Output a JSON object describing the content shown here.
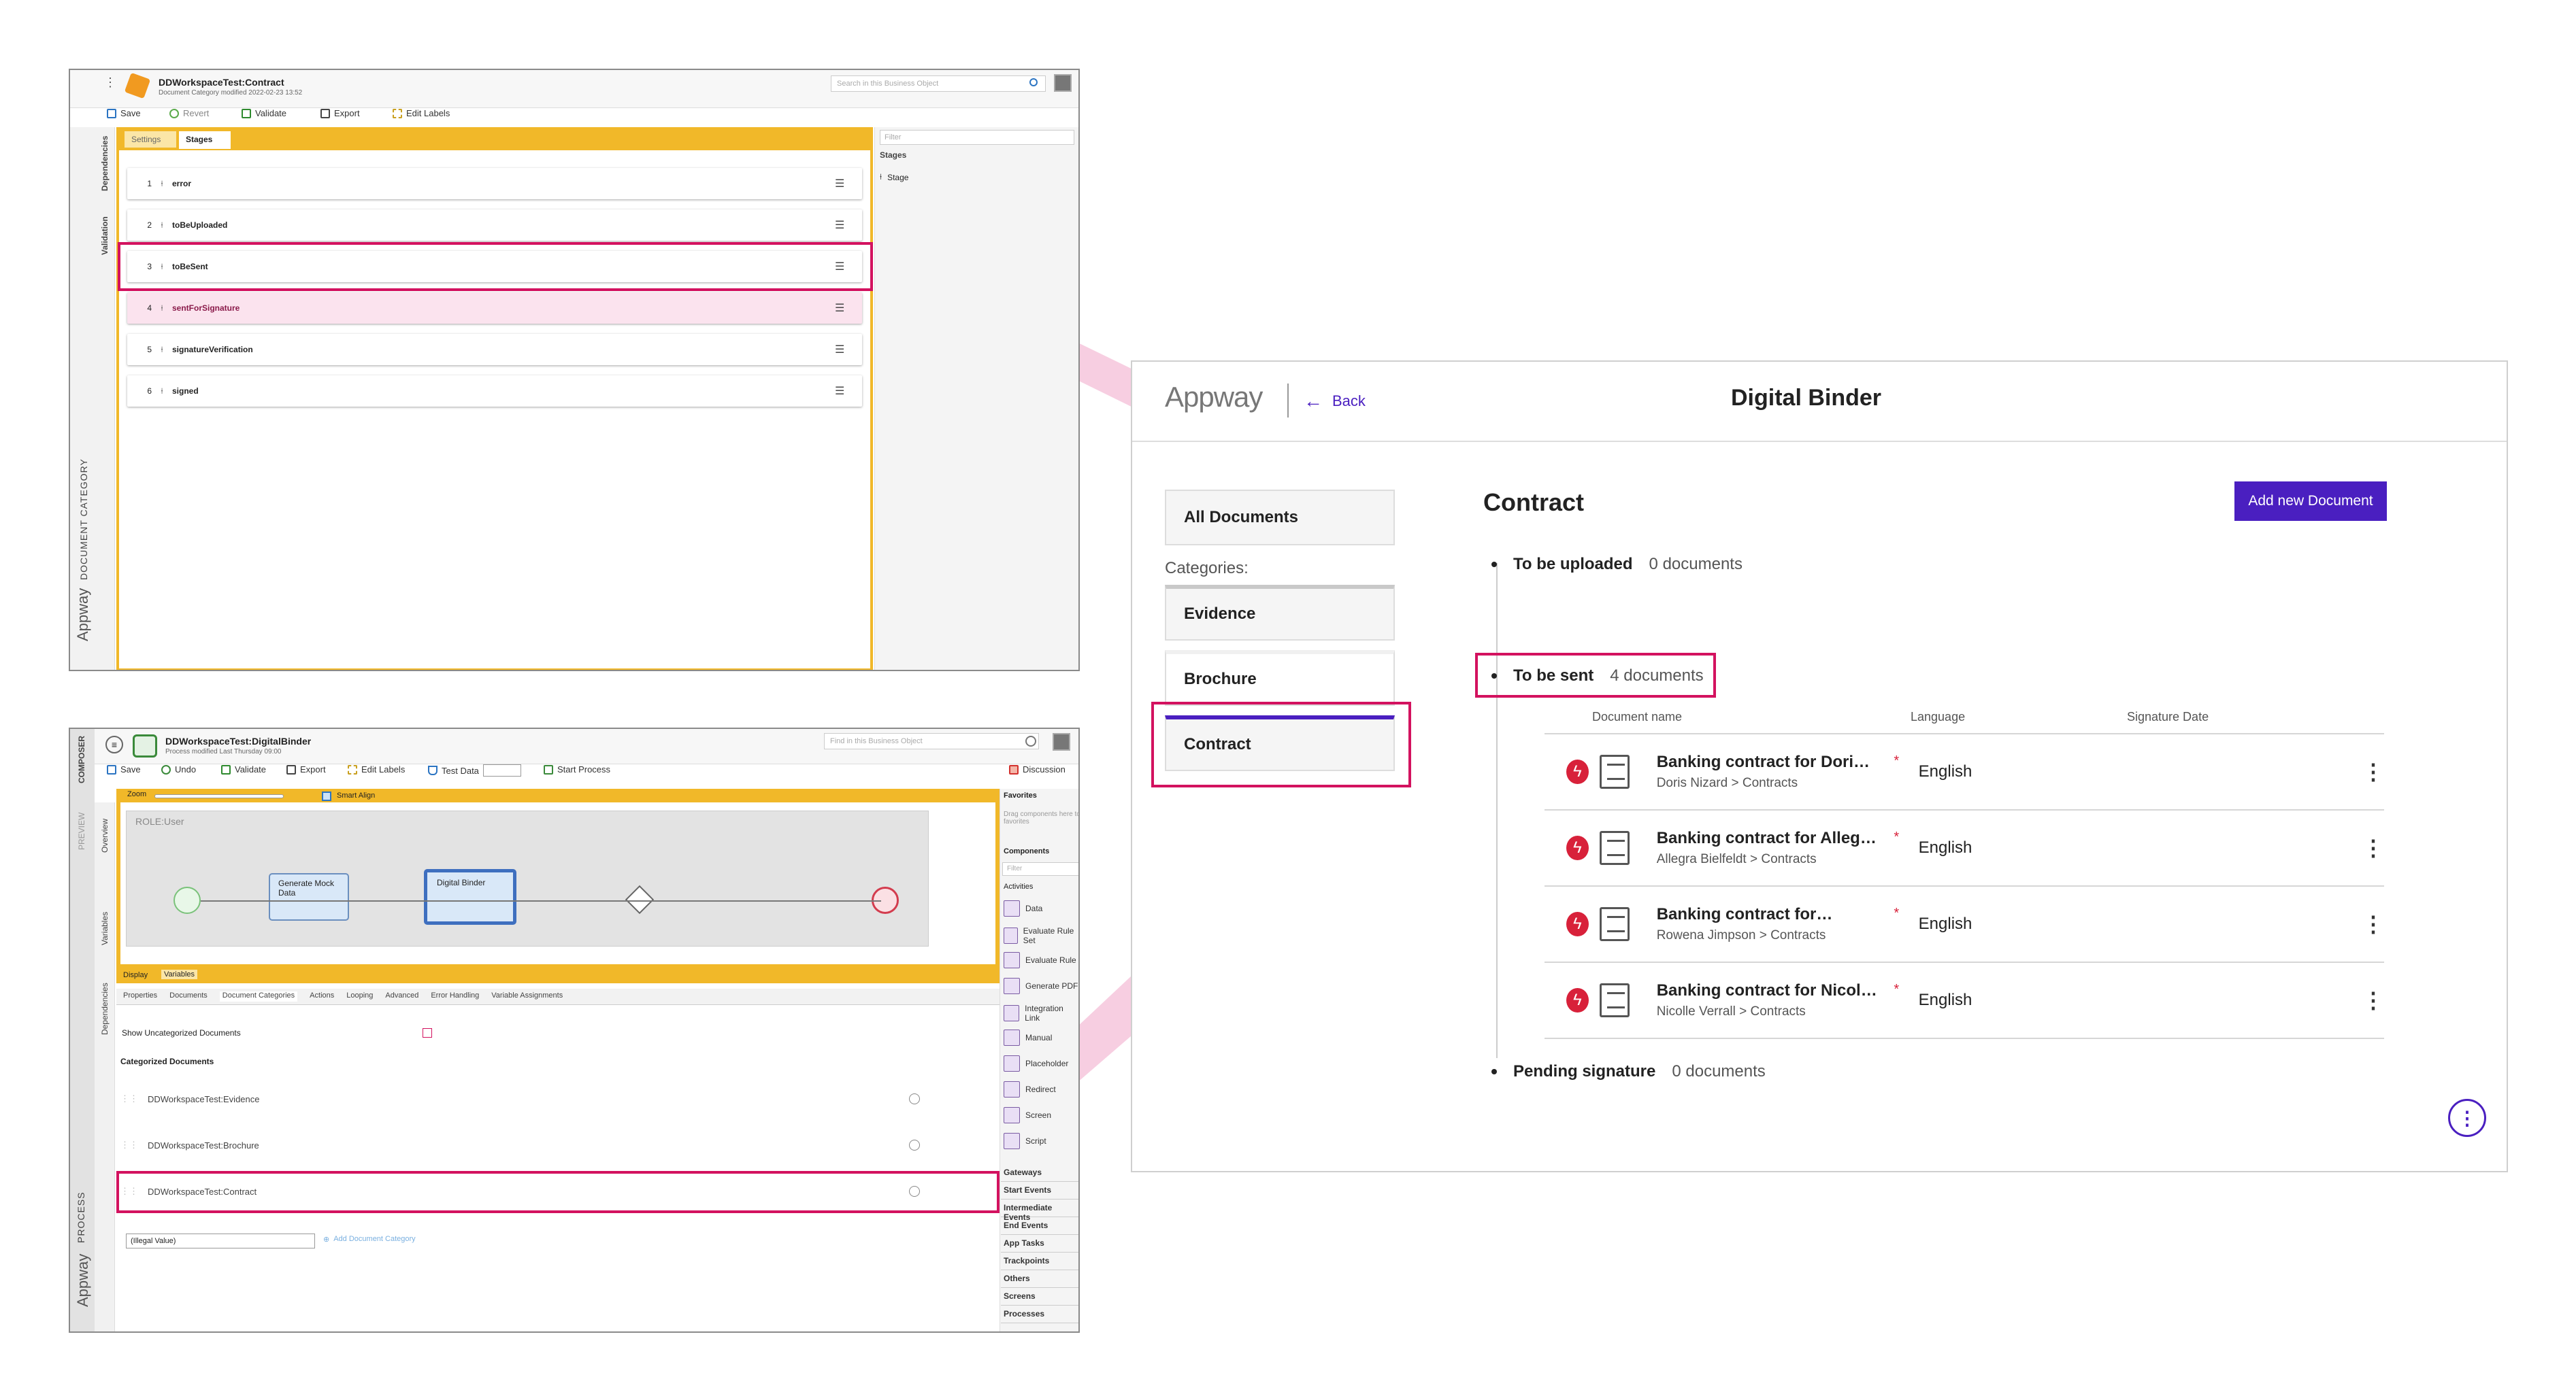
{
  "overlay": {
    "highlight_color": "#d3125f",
    "band_color": "#f6c6dc"
  },
  "panel1": {
    "title": "DDWorkspaceTest:Contract",
    "subtitle": "Document Category modified 2022-02-23 13:52",
    "search_placeholder": "Search in this Business Object",
    "toolbar": {
      "save": "Save",
      "revert": "Revert",
      "validate": "Validate",
      "export": "Export",
      "edit_labels": "Edit Labels"
    },
    "tabs": [
      "Settings",
      "Stages"
    ],
    "left_tabs": [
      "Dependencies",
      "Validation"
    ],
    "vertical_brand": "Appway",
    "vertical_caption": "DOCUMENT CATEGORY",
    "stages": [
      {
        "num": "1",
        "label": "error"
      },
      {
        "num": "2",
        "label": "toBeUploaded"
      },
      {
        "num": "3",
        "label": "toBeSent"
      },
      {
        "num": "4",
        "label": "sentForSignature"
      },
      {
        "num": "5",
        "label": "signatureVerification"
      },
      {
        "num": "6",
        "label": "signed"
      }
    ],
    "side_filter_placeholder": "Filter",
    "side_section": "Stages",
    "side_item": "Stage"
  },
  "panel2": {
    "title": "DDWorkspaceTest:DigitalBinder",
    "subtitle": "Process modified Last Thursday 09:00",
    "search_placeholder": "Find in this Business Object",
    "toolbar": {
      "save": "Save",
      "undo": "Undo",
      "validate": "Validate",
      "export": "Export",
      "edit_labels": "Edit Labels",
      "test_data": "Test Data",
      "start_process": "Start Process",
      "discussion": "Discussion"
    },
    "left_tabs": [
      "COMPOSER",
      "PREVIEW",
      "Overview",
      "Variables",
      "Dependencies"
    ],
    "vertical_brand": "Appway",
    "vertical_caption": "PROCESS",
    "zoom_label": "Zoom",
    "smart_align": "Smart Align",
    "role": "ROLE:User",
    "task1": "Generate Mock Data",
    "task2": "Digital Binder",
    "canvas_tabs": [
      "Display",
      "Variables"
    ],
    "prop_tabs": [
      "Properties",
      "Documents",
      "Document Categories",
      "Actions",
      "Looping",
      "Advanced",
      "Error Handling",
      "Variable Assignments"
    ],
    "show_uncat": "Show Uncategorized Documents",
    "categorized": "Categorized Documents",
    "categories": [
      "DDWorkspaceTest:Evidence",
      "DDWorkspaceTest:Brochure",
      "DDWorkspaceTest:Contract"
    ],
    "select_value": "(Illegal Value)",
    "add_category": "Add Document Category",
    "favorites": "Favorites",
    "drag_hint": "Drag components here to pin them as your favorites",
    "components": "Components",
    "filter": "Filter",
    "activities": "Activities",
    "activity_items": [
      "Data",
      "Evaluate Rule Set",
      "Evaluate Rule",
      "Generate PDF",
      "Integration Link",
      "Manual",
      "Placeholder",
      "Redirect",
      "Screen",
      "Script"
    ],
    "sections": [
      "Gateways",
      "Start Events",
      "Intermediate Events",
      "End Events",
      "App Tasks",
      "Trackpoints",
      "Others",
      "Screens",
      "Processes"
    ]
  },
  "binder": {
    "brand": "Appway",
    "back": "Back",
    "title": "Digital Binder",
    "all_documents": "All Documents",
    "categories_label": "Categories:",
    "categories": [
      "Evidence",
      "Brochure",
      "Contract"
    ],
    "heading": "Contract",
    "add_button": "Add new Document",
    "stages": [
      {
        "name": "To be uploaded",
        "count": "0 documents"
      },
      {
        "name": "To be sent",
        "count": "4 documents"
      },
      {
        "name": "Pending signature",
        "count": "0 documents"
      }
    ],
    "columns": [
      "Document name",
      "Language",
      "Signature Date"
    ],
    "documents": [
      {
        "name": "Banking contract for Dori…",
        "path": "Doris Nizard > Contracts",
        "lang": "English",
        "star": "*"
      },
      {
        "name": "Banking contract for Alleg…",
        "path": "Allegra Bielfeldt > Contracts",
        "lang": "English",
        "star": "*"
      },
      {
        "name": "Banking contract for…",
        "path": "Rowena Jimpson > Contracts",
        "lang": "English",
        "star": "*"
      },
      {
        "name": "Banking contract for Nicol…",
        "path": "Nicolle Verrall > Contracts",
        "lang": "English",
        "star": "*"
      }
    ],
    "accent": "#4a1fc0"
  }
}
